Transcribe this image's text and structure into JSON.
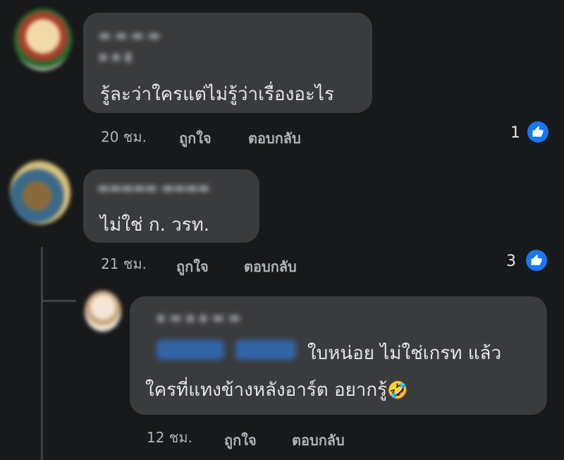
{
  "comments": [
    {
      "text": "รู้ละว่าใครแต่ไม่รู้ว่าเรื่องอะไร",
      "time": "20 ชม.",
      "like_label": "ถูกใจ",
      "reply_label": "ตอบกลับ",
      "like_count": "1"
    },
    {
      "text": "ไม่ใช่ ก. วรท.",
      "time": "21 ชม.",
      "like_label": "ถูกใจ",
      "reply_label": "ตอบกลับ",
      "like_count": "3"
    }
  ],
  "reply": {
    "text_line1": "ใบหน่อย ไม่ใช่เกรท แล้ว",
    "text_line2": "ใครที่แทงข้างหลังอาร์ต อยากรู้",
    "emoji": "🤣",
    "time": "12 ชม.",
    "like_label": "ถูกใจ",
    "reply_label": "ตอบกลับ"
  },
  "colors": {
    "background": "#18191a",
    "bubble": "#3a3b3c",
    "like_blue": "#1877f2",
    "meta_text": "#b0b3b8"
  }
}
